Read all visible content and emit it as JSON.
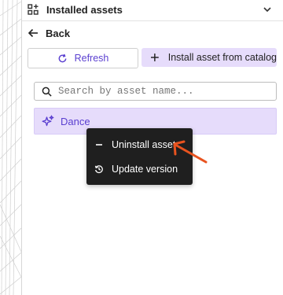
{
  "header": {
    "title": "Installed assets",
    "icon": "apps-add-icon",
    "collapse_icon": "chevron-down-icon"
  },
  "back": {
    "label": "Back",
    "icon": "arrow-left-icon"
  },
  "toolbar": {
    "refresh_label": "Refresh",
    "refresh_icon": "refresh-icon",
    "install_label": "Install asset from catalog",
    "install_icon": "plus-icon"
  },
  "search": {
    "placeholder": "Search by asset name...",
    "value": "",
    "icon": "search-icon"
  },
  "assets": [
    {
      "name": "Dance",
      "icon": "sparkle-icon",
      "selected": true
    }
  ],
  "context_menu": {
    "items": [
      {
        "label": "Uninstall asset",
        "icon": "minus-icon"
      },
      {
        "label": "Update version",
        "icon": "history-icon"
      }
    ]
  },
  "colors": {
    "accent": "#5a3fd0",
    "accent_bg": "#e6dcfb",
    "menu_bg": "#1f1f1f",
    "annotation_arrow": "#e8531f"
  }
}
